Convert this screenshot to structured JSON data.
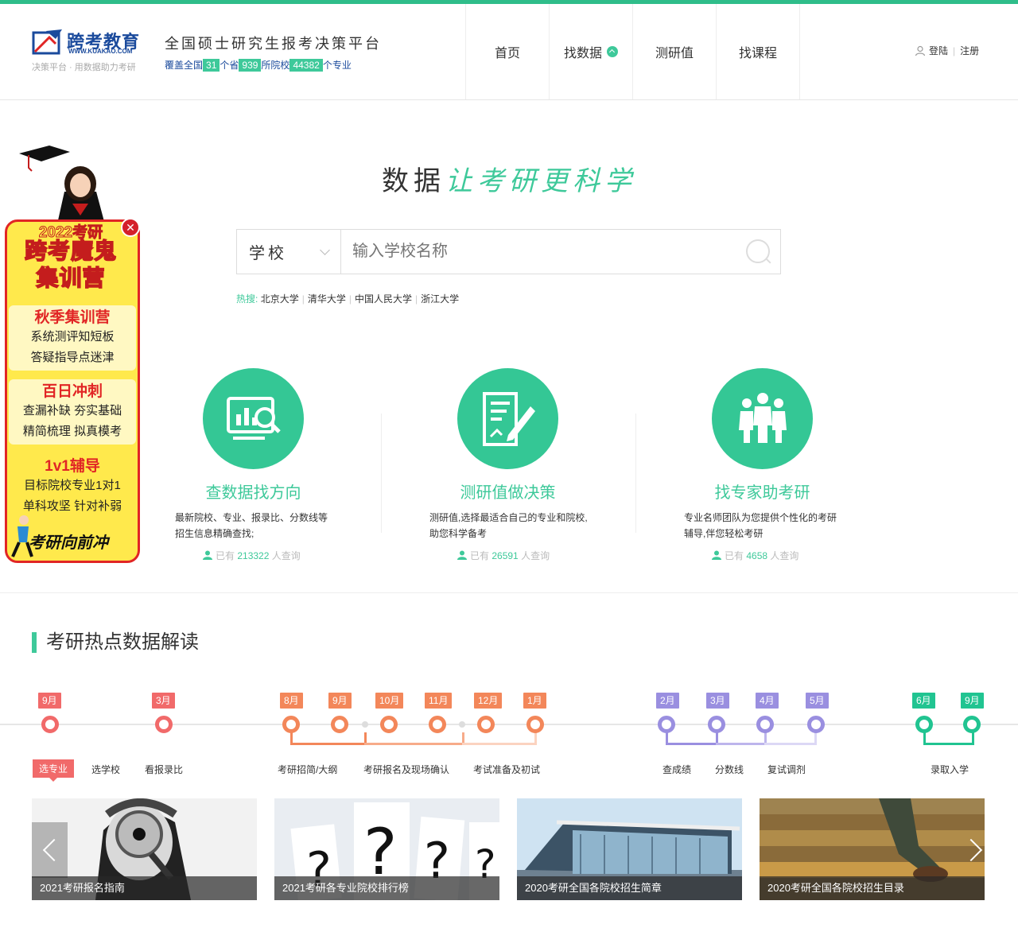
{
  "header": {
    "logo_cn": "跨考教育",
    "logo_en": "WWW.KUAKAO.COM",
    "logo_sub": "决策平台 · 用数据助力考研",
    "slogan": "全国硕士研究生报考决策平台",
    "stats": {
      "prefix": "覆盖全国",
      "provinces": "31",
      "mid1": "个省",
      "schools": "939",
      "mid2": "所院校",
      "majors": "44382",
      "suffix": "个专业"
    },
    "nav": [
      "首页",
      "找数据",
      "测研值",
      "找课程"
    ],
    "login": "登陆",
    "register": "注册"
  },
  "hero": {
    "title_a": "数据",
    "title_b": "让考研更科学"
  },
  "search": {
    "type": "学校",
    "placeholder": "输入学校名称"
  },
  "hot": {
    "label": "热搜:",
    "items": [
      "北京大学",
      "清华大学",
      "中国人民大学",
      "浙江大学"
    ]
  },
  "promo": {
    "year": "2022考研",
    "title1": "跨考魔鬼",
    "title2": "集训营",
    "blocks": [
      {
        "title": "秋季集训营",
        "lines": [
          "系统测评知短板",
          "答疑指导点迷津"
        ]
      },
      {
        "title": "百日冲刺",
        "lines": [
          "查漏补缺  夯实基础",
          "精简梳理  拟真模考"
        ]
      },
      {
        "title": "1v1辅导",
        "lines": [
          "目标院校专业1对1",
          "单科攻坚  针对补弱"
        ]
      }
    ],
    "footer": "考研向前冲"
  },
  "features": [
    {
      "title": "查数据找方向",
      "desc": "最新院校、专业、报录比、分数线等招生信息精确查找;",
      "count_prefix": "已有",
      "count": "213322",
      "count_suffix": "人查询",
      "icon": "chart-search-icon"
    },
    {
      "title": "测研值做决策",
      "desc": "测研值,选择最适合自己的专业和院校,助您科学备考",
      "count_prefix": "已有",
      "count": "26591",
      "count_suffix": "人查询",
      "icon": "document-edit-icon"
    },
    {
      "title": "找专家助考研",
      "desc": "专业名师团队为您提供个性化的考研辅导,伴您轻松考研",
      "count_prefix": "已有",
      "count": "4658",
      "count_suffix": "人查询",
      "icon": "people-group-icon"
    }
  ],
  "section_title": "考研热点数据解读",
  "timeline": {
    "groups": [
      {
        "color": "#f16a6a",
        "months": [
          "9月",
          "3月"
        ],
        "labels": [
          "选专业",
          "选学校",
          "看报录比"
        ]
      },
      {
        "color": "#f3875a",
        "months": [
          "8月",
          "9月",
          "10月",
          "11月",
          "12月",
          "1月"
        ],
        "labels": [
          "考研招简/大纲",
          "考研报名及现场确认",
          "考试准备及初试"
        ]
      },
      {
        "color": "#9a8fe0",
        "months": [
          "2月",
          "3月",
          "4月",
          "5月"
        ],
        "labels": [
          "查成绩",
          "分数线",
          "复试调剂"
        ]
      },
      {
        "color": "#21c491",
        "months": [
          "6月",
          "9月"
        ],
        "labels": [
          "录取入学"
        ]
      }
    ]
  },
  "cards": [
    {
      "caption": "2021考研报名指南"
    },
    {
      "caption": "2021考研各专业院校排行榜"
    },
    {
      "caption": "2020考研全国各院校招生简章"
    },
    {
      "caption": "2020考研全国各院校招生目录"
    }
  ]
}
